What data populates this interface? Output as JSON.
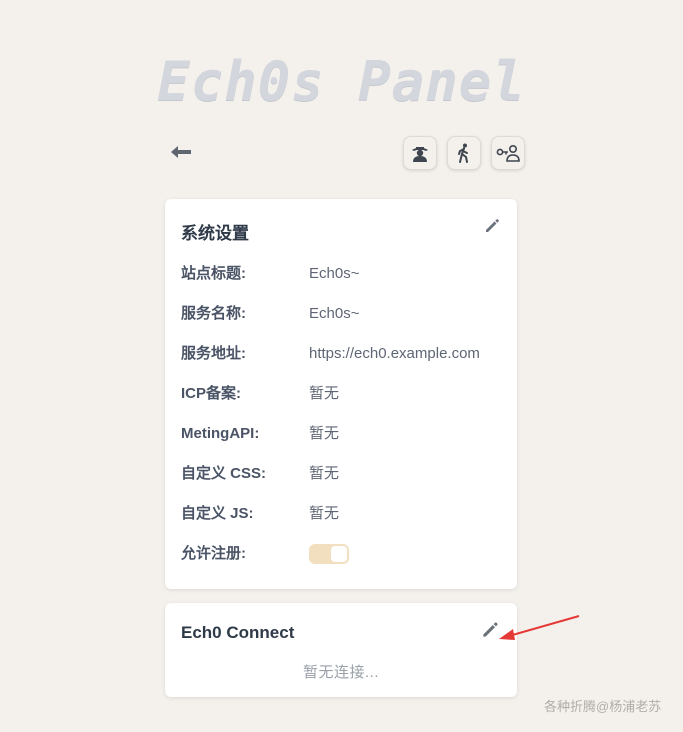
{
  "app": {
    "brand_title": "Ech0s Panel"
  },
  "toolbar": {
    "back_icon": "arrow-left-icon",
    "buttons": [
      {
        "name": "user-hat-icon"
      },
      {
        "name": "walking-person-icon"
      },
      {
        "name": "user-key-icon"
      }
    ]
  },
  "system_settings": {
    "title": "系统设置",
    "edit_icon": "pencil-icon",
    "rows": [
      {
        "label": "站点标题:",
        "value": "Ech0s~"
      },
      {
        "label": "服务名称:",
        "value": "Ech0s~"
      },
      {
        "label": "服务地址:",
        "value": "https://ech0.example.com"
      },
      {
        "label": "ICP备案:",
        "value": "暂无"
      },
      {
        "label": "MetingAPI:",
        "value": "暂无"
      },
      {
        "label": "自定义 CSS:",
        "value": "暂无"
      },
      {
        "label": "自定义 JS:",
        "value": "暂无"
      }
    ],
    "allow_register": {
      "label": "允许注册:",
      "enabled": true,
      "accent_color": "#f1dfbf"
    }
  },
  "connect": {
    "title": "Ech0 Connect",
    "edit_icon": "pencil-icon",
    "empty_text": "暂无连接..."
  },
  "annotation": {
    "arrow_color": "#e53935"
  },
  "watermark": {
    "text": "各种折腾@杨浦老苏"
  }
}
